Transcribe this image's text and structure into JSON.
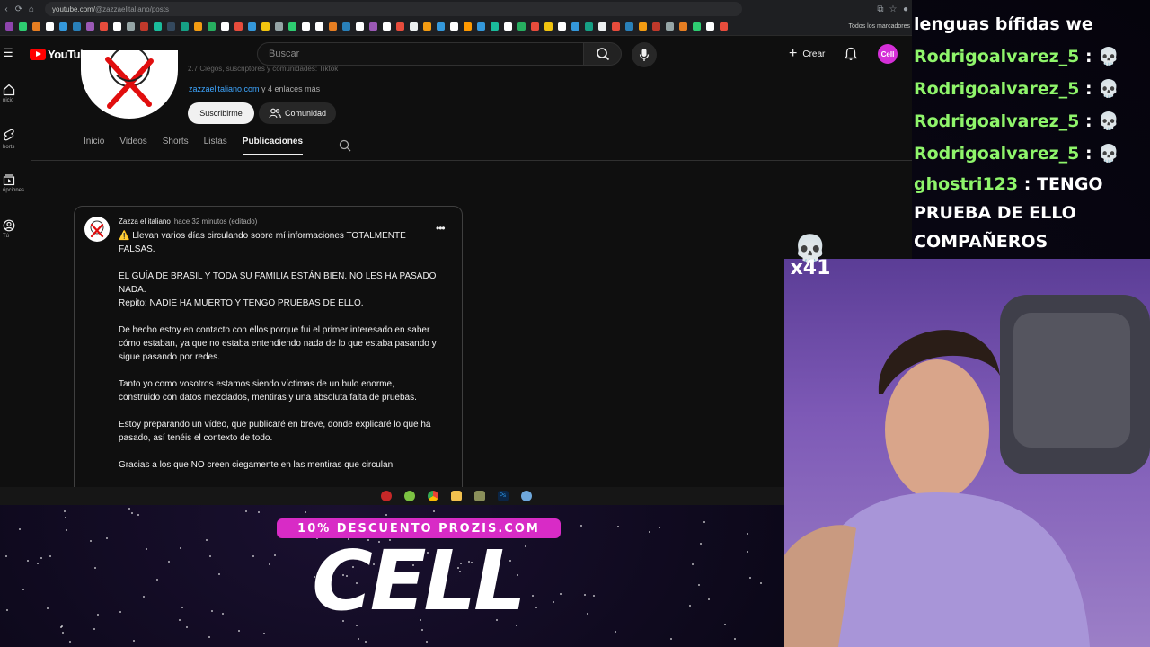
{
  "browser": {
    "url_host": "youtube.com/",
    "url_path": "@zazzaelitaliano/posts",
    "bookmarks_all": "Todos los marcadores",
    "bookmark_colors": [
      "#8e44ad",
      "#2ecc71",
      "#e67e22",
      "#ffffff",
      "#3498db",
      "#2980b9",
      "#9b59b6",
      "#e74c3c",
      "#ffffff",
      "#95a5a6",
      "#c0392b",
      "#1abc9c",
      "#34495e",
      "#16a085",
      "#f39c12",
      "#27ae60",
      "#ffffff",
      "#e74c3c",
      "#3498db",
      "#f1c40f",
      "#95a5a6",
      "#2ecc71",
      "#ffffff",
      "#ffffff",
      "#e67e22",
      "#2980b9",
      "#ffffff",
      "#9b59b6",
      "#ffffff",
      "#e74c3c",
      "#ecf0f1",
      "#f39c12",
      "#3498db",
      "#ffffff",
      "#ff9900",
      "#3498db",
      "#1abc9c",
      "#ffffff",
      "#27ae60",
      "#e74c3c",
      "#f1c40f",
      "#ffffff",
      "#3498db",
      "#16a085",
      "#ecf0f1",
      "#e74c3c",
      "#2980b9",
      "#f39c12",
      "#c0392b",
      "#95a5a6",
      "#e67e22",
      "#2ecc71",
      "#ffffff",
      "#e74c3c"
    ]
  },
  "youtube": {
    "logo": "YouTube",
    "search_placeholder": "Buscar",
    "create_label": "Crear",
    "avatar_label": "Cell",
    "rail": [
      {
        "label": "nicio",
        "icon": "home-icon"
      },
      {
        "label": "horts",
        "icon": "shorts-icon"
      },
      {
        "label": "ripciones",
        "icon": "subscriptions-icon"
      },
      {
        "label": "Tú",
        "icon": "you-icon"
      }
    ],
    "channel": {
      "meta": "2.7 Ciegos, suscriptores y comunidades: Tiktok",
      "link_text": "zazzaelitaliano.com",
      "link_more": " y 4 enlaces más",
      "subscribe": "Suscribirme",
      "community": "Comunidad",
      "tabs": [
        "Inicio",
        "Videos",
        "Shorts",
        "Listas",
        "Publicaciones"
      ],
      "active_tab": "Publicaciones"
    },
    "post": {
      "author": "Zazza el italiano",
      "time": "hace 32 minutos (editado)",
      "paragraphs": [
        "⚠️ Llevan varios días circulando sobre mí informaciones TOTALMENTE FALSAS.",
        "EL GUÍA DE BRASIL Y TODA SU FAMILIA ESTÁN BIEN. NO LES HA PASADO NADA.\nRepito: NADIE HA MUERTO Y TENGO PRUEBAS DE ELLO.",
        "De hecho estoy en contacto con ellos porque fui el primer interesado en saber cómo estaban, ya que no estaba entendiendo nada de lo que estaba pasando y sigue pasando por redes.",
        "Tanto yo como vosotros estamos siendo víctimas de un bulo enorme, construido con datos mezclados, mentiras y una absoluta falta de pruebas.",
        "Estoy preparando un vídeo, que publicaré en breve, donde explicaré lo que ha pasado, así tenéis el contexto de todo.",
        "Gracias a los que NO creen ciegamente en las mentiras que circulan"
      ]
    }
  },
  "chat": {
    "top_partial": "lenguas bífidas we",
    "lines": [
      {
        "user": "Rodrigoalvarez_5",
        "msg": "💀"
      },
      {
        "user": "Rodrigoalvarez_5",
        "msg": "💀"
      },
      {
        "user": "Rodrigoalvarez_5",
        "msg": "💀"
      },
      {
        "user": "Rodrigoalvarez_5",
        "msg": "💀"
      },
      {
        "user": "ghostri123",
        "msg": "TENGO"
      }
    ],
    "continuation": [
      "PRUEBA DE ELLO",
      "COMPAÑEROS"
    ],
    "separator": ":"
  },
  "overlay": {
    "skull_count": "x41",
    "promo_banner": "10% DESCUENTO PROZIS.COM",
    "promo_title": "CELL"
  }
}
